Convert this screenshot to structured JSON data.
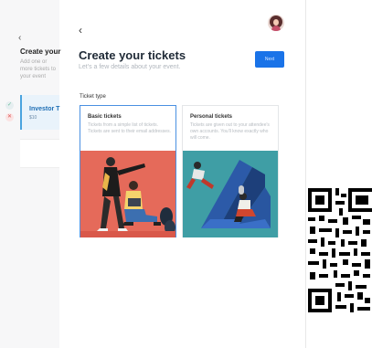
{
  "left_preview": {
    "back_label": "‹",
    "title": "Create your",
    "subtitle": "Add one or more tickets to your event",
    "card_title": "Investor T",
    "card_sub": "$10"
  },
  "header": {
    "back_label": "‹",
    "title": "Create your tickets",
    "subtitle": "Let's a few details about your event.",
    "primary_button_label": "Next"
  },
  "ticket_type": {
    "label": "Ticket type",
    "options": [
      {
        "title": "Basic tickets",
        "description": "Tickets from a simple list of tickets. Tickets are sent to their email addresses.",
        "selected": true
      },
      {
        "title": "Personal tickets",
        "description": "Tickets are given out to your attendee's own accounts. You'll know exactly who will come.",
        "selected": false
      }
    ]
  },
  "colors": {
    "primary": "#1a73e8",
    "selected_border": "#4a90e2",
    "illustration_a_bg": "#e56a5a",
    "illustration_b_bg": "#3f9ea5"
  },
  "icons": {
    "back": "chevron-left-icon",
    "check": "check-icon",
    "close": "close-icon",
    "avatar": "user-avatar"
  }
}
